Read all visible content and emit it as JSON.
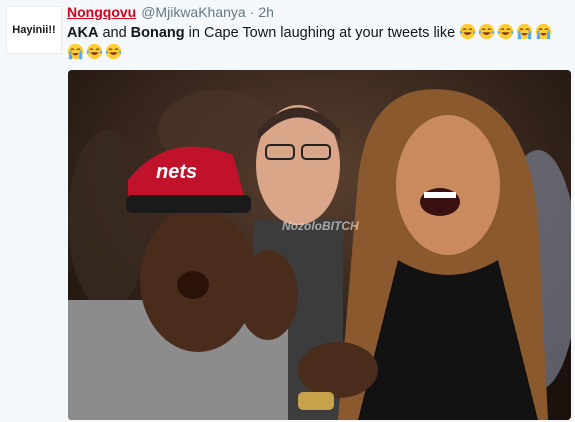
{
  "author": {
    "avatar_text": "Hayinii!!",
    "display_name": "Nongqovu",
    "screen_name": "@MjikwaKhanya",
    "separator": "·",
    "time": "2h"
  },
  "tweet": {
    "name1": "AKA",
    "word_and": " and ",
    "name2": "Bonang",
    "rest": " in Cape Town laughing at your tweets like",
    "emojis": [
      "laughing-crying",
      "laughing-crying",
      "laughing-crying",
      "loud-crying",
      "loud-crying",
      "loud-crying",
      "laughing-crying",
      "laughing-crying"
    ]
  },
  "photo": {
    "cap_text": "nets",
    "watermark": "NozoloBITCH"
  },
  "colors": {
    "display_name": "#d0021b",
    "meta": "#657786",
    "text": "#14171a"
  }
}
